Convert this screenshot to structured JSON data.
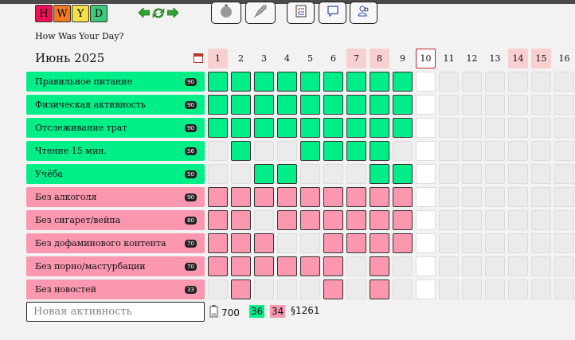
{
  "app": {
    "logo_letters": [
      {
        "letter": "H",
        "color": "#ee1155"
      },
      {
        "letter": "W",
        "color": "#f07a22"
      },
      {
        "letter": "Y",
        "color": "#f4e04a"
      },
      {
        "letter": "D",
        "color": "#3fc77b"
      }
    ],
    "subtitle": "How Was Your Day?",
    "nav_icons": [
      "arrow-left-icon",
      "refresh-icon",
      "arrow-right-icon"
    ],
    "toolbar_icons": [
      "tomato-icon",
      "rocket-icon",
      "checklist-icon",
      "comment-icon",
      "users-icon"
    ]
  },
  "calendar": {
    "month_title": "Июнь 2025",
    "days": [
      {
        "n": "1",
        "weekend": true
      },
      {
        "n": "2",
        "weekend": false
      },
      {
        "n": "3",
        "weekend": false
      },
      {
        "n": "4",
        "weekend": false
      },
      {
        "n": "5",
        "weekend": false
      },
      {
        "n": "6",
        "weekend": false
      },
      {
        "n": "7",
        "weekend": true
      },
      {
        "n": "8",
        "weekend": true
      },
      {
        "n": "9",
        "weekend": false
      },
      {
        "n": "10",
        "today": true
      },
      {
        "n": "11",
        "weekend": false
      },
      {
        "n": "12",
        "weekend": false
      },
      {
        "n": "13",
        "weekend": false
      },
      {
        "n": "14",
        "weekend": true
      },
      {
        "n": "15",
        "weekend": true
      },
      {
        "n": "16",
        "weekend": false
      }
    ]
  },
  "habits": [
    {
      "name": "Правильное питание",
      "score": "90",
      "kind": "pos",
      "done": [
        1,
        1,
        1,
        1,
        1,
        1,
        1,
        1,
        1
      ]
    },
    {
      "name": "Физическая активность",
      "score": "90",
      "kind": "pos",
      "done": [
        1,
        1,
        1,
        1,
        1,
        1,
        1,
        1,
        1
      ]
    },
    {
      "name": "Отслеживание трат",
      "score": "90",
      "kind": "pos",
      "done": [
        1,
        1,
        1,
        1,
        1,
        1,
        1,
        1,
        1
      ]
    },
    {
      "name": "Чтение 15 мин.",
      "score": "56",
      "kind": "pos",
      "done": [
        0,
        1,
        0,
        0,
        1,
        1,
        1,
        1,
        0
      ]
    },
    {
      "name": "Учёба",
      "score": "50",
      "kind": "pos",
      "done": [
        0,
        0,
        1,
        1,
        0,
        0,
        0,
        1,
        1
      ]
    },
    {
      "name": "Без алкоголя",
      "score": "90",
      "kind": "neg",
      "done": [
        1,
        1,
        1,
        1,
        1,
        1,
        1,
        1,
        1
      ]
    },
    {
      "name": "Без сигарет/вейпа",
      "score": "80",
      "kind": "neg",
      "done": [
        1,
        1,
        0,
        1,
        1,
        1,
        1,
        1,
        1
      ]
    },
    {
      "name": "Без дофаминового контента",
      "score": "70",
      "kind": "neg",
      "done": [
        1,
        1,
        1,
        0,
        0,
        1,
        1,
        1,
        1
      ]
    },
    {
      "name": "Без порно/мастурбации",
      "score": "70",
      "kind": "neg",
      "done": [
        1,
        1,
        1,
        1,
        1,
        1,
        0,
        1,
        0
      ]
    },
    {
      "name": "Без новостей",
      "score": "33",
      "kind": "neg",
      "done": [
        0,
        1,
        0,
        0,
        0,
        1,
        0,
        1,
        0
      ]
    }
  ],
  "new_activity": {
    "placeholder": "Новая активность"
  },
  "footer": {
    "total_points": "700",
    "positive_count": "36",
    "negative_count": "34",
    "section_total": "§1261"
  },
  "colors": {
    "positive": "#00ee88",
    "negative": "#fb97ae",
    "weekend": "#f8d0d0"
  }
}
